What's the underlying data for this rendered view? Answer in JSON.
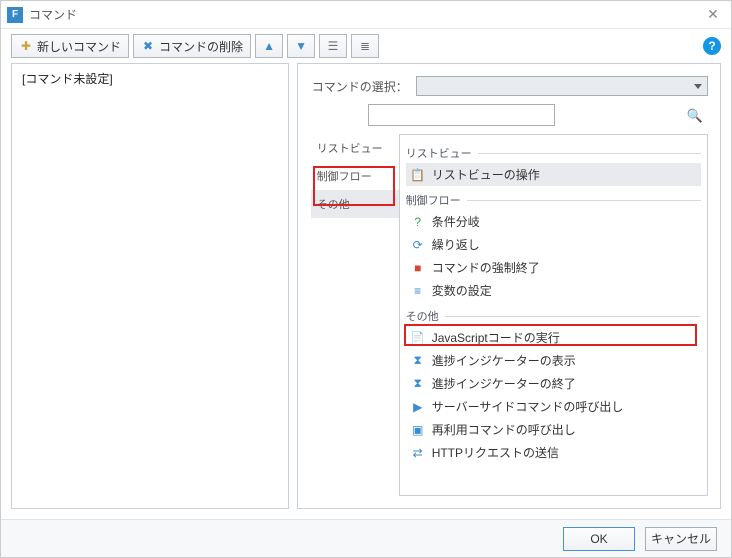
{
  "window": {
    "title": "コマンド"
  },
  "toolbar": {
    "new_cmd": "新しいコマンド",
    "del_cmd": "コマンドの削除"
  },
  "left": {
    "unset_cmd": "[コマンド未設定]"
  },
  "right": {
    "select_label": "コマンドの選択：",
    "search_placeholder": "",
    "categories": [
      "リストビュー",
      "制御フロー",
      "その他"
    ],
    "sections": [
      {
        "title": "リストビュー",
        "items": [
          {
            "label": "リストビューの操作",
            "icon": "📋",
            "iconColor": "#3a8bd0",
            "hl": true
          }
        ]
      },
      {
        "title": "制御フロー",
        "items": [
          {
            "label": "条件分岐",
            "icon": "?",
            "iconColor": "#2fa84f"
          },
          {
            "label": "繰り返し",
            "icon": "⟳",
            "iconColor": "#3a8bd0"
          },
          {
            "label": "コマンドの強制終了",
            "icon": "■",
            "iconColor": "#d24a3a"
          },
          {
            "label": "変数の設定",
            "icon": "≡",
            "iconColor": "#3a8bd0"
          }
        ]
      },
      {
        "title": "その他",
        "items": [
          {
            "label": "JavaScriptコードの実行",
            "icon": "📄",
            "iconColor": "#3a8bd0",
            "redbox": true
          },
          {
            "label": "進捗インジケーターの表示",
            "icon": "⧗",
            "iconColor": "#3a8bd0"
          },
          {
            "label": "進捗インジケーターの終了",
            "icon": "⧗",
            "iconColor": "#3a8bd0"
          },
          {
            "label": "サーバーサイドコマンドの呼び出し",
            "icon": "▶",
            "iconColor": "#3a8bd0"
          },
          {
            "label": "再利用コマンドの呼び出し",
            "icon": "▣",
            "iconColor": "#3a8bd0"
          },
          {
            "label": "HTTPリクエストの送信",
            "icon": "⇄",
            "iconColor": "#3a8bd0"
          }
        ]
      }
    ]
  },
  "footer": {
    "ok": "OK",
    "cancel": "キャンセル"
  }
}
